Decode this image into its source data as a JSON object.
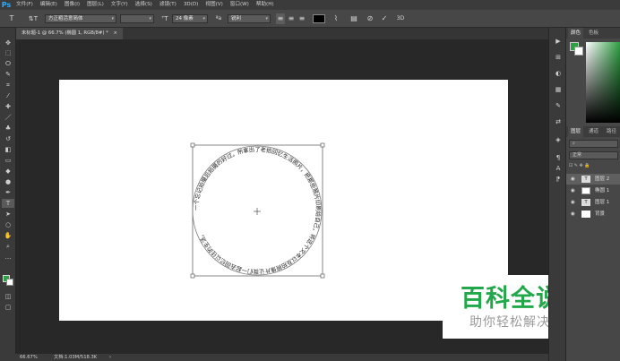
{
  "menu": {
    "logo": "Ps",
    "items": [
      "文件(F)",
      "编辑(E)",
      "图像(I)",
      "图层(L)",
      "文字(Y)",
      "选择(S)",
      "滤镜(T)",
      "3D(D)",
      "视图(V)",
      "窗口(W)",
      "帮助(H)"
    ]
  },
  "options": {
    "font_family": "方正粗活意简体",
    "font_style": "",
    "font_size": "24 像素",
    "antialias": "锐利",
    "btn_3d": "3D"
  },
  "document": {
    "tab_title": "未标题-1 @ 66.7% (椭圆 1, RGB/8#) *",
    "close": "×"
  },
  "circle_text": "一个忘记拍摄后拍摄的好过。所拿出了老拍回忆生活照片，把那些照片印刷给自己，将这个文本以及拍照像片让我们一起去回忆以往的生活。",
  "right_panel": {
    "color_tab": "颜色",
    "swatches_tab": "色板",
    "layers_tab": "图层",
    "channels_tab": "通道",
    "paths_tab": "路径",
    "kind_label": "正常",
    "layers": [
      {
        "name": "图层 2",
        "thumb": "T"
      },
      {
        "name": "椭圆 1",
        "thumb": ""
      },
      {
        "name": "图层 1",
        "thumb": "T"
      },
      {
        "name": "背景",
        "thumb": ""
      }
    ]
  },
  "status": {
    "zoom": "66.67%",
    "doc_size": "文档:1.03M/518.3K"
  },
  "watermark": {
    "title": "百科全说",
    "subtitle": "助你轻松解决"
  },
  "colors": {
    "accent": "#31a8ff",
    "fg_swatch": "#2ea043",
    "watermark_green": "#22a84a"
  }
}
